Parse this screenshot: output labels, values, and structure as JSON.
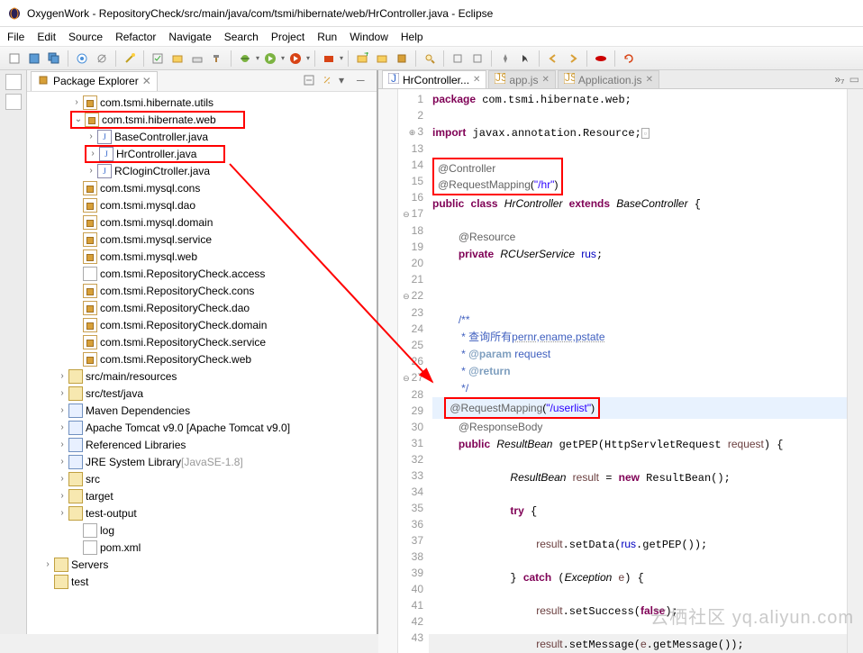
{
  "title": "OxygenWork - RepositoryCheck/src/main/java/com/tsmi/hibernate/web/HrController.java - Eclipse",
  "menubar": [
    "File",
    "Edit",
    "Source",
    "Refactor",
    "Navigate",
    "Search",
    "Project",
    "Run",
    "Window",
    "Help"
  ],
  "explorer": {
    "title": "Package Explorer",
    "items": [
      {
        "indent": 3,
        "twist": ">",
        "icon": "pkg",
        "label": "com.tsmi.hibernate.utils"
      },
      {
        "indent": 3,
        "twistOpen": true,
        "icon": "pkg",
        "label": "com.tsmi.hibernate.web",
        "hl": true
      },
      {
        "indent": 4,
        "twist": ">",
        "icon": "java",
        "label": "BaseController.java"
      },
      {
        "indent": 4,
        "twist": ">",
        "icon": "java",
        "label": "HrController.java",
        "hl": true
      },
      {
        "indent": 4,
        "twist": ">",
        "icon": "java",
        "label": "RCloginCtroller.java"
      },
      {
        "indent": 3,
        "icon": "pkg",
        "label": "com.tsmi.mysql.cons"
      },
      {
        "indent": 3,
        "icon": "pkg",
        "label": "com.tsmi.mysql.dao"
      },
      {
        "indent": 3,
        "icon": "pkg",
        "label": "com.tsmi.mysql.domain"
      },
      {
        "indent": 3,
        "icon": "pkg",
        "label": "com.tsmi.mysql.service"
      },
      {
        "indent": 3,
        "icon": "pkg",
        "label": "com.tsmi.mysql.web"
      },
      {
        "indent": 3,
        "icon": "file",
        "label": "com.tsmi.RepositoryCheck.access"
      },
      {
        "indent": 3,
        "icon": "pkg",
        "label": "com.tsmi.RepositoryCheck.cons"
      },
      {
        "indent": 3,
        "icon": "pkg",
        "label": "com.tsmi.RepositoryCheck.dao"
      },
      {
        "indent": 3,
        "icon": "pkg",
        "label": "com.tsmi.RepositoryCheck.domain"
      },
      {
        "indent": 3,
        "icon": "pkg",
        "label": "com.tsmi.RepositoryCheck.service"
      },
      {
        "indent": 3,
        "icon": "pkg",
        "label": "com.tsmi.RepositoryCheck.web"
      },
      {
        "indent": 2,
        "twist": ">",
        "icon": "fold",
        "label": "src/main/resources"
      },
      {
        "indent": 2,
        "twist": ">",
        "icon": "fold",
        "label": "src/test/java"
      },
      {
        "indent": 2,
        "twist": ">",
        "icon": "jar",
        "label": "Maven Dependencies"
      },
      {
        "indent": 2,
        "twist": ">",
        "icon": "jar",
        "label": "Apache Tomcat v9.0 [Apache Tomcat v9.0]"
      },
      {
        "indent": 2,
        "twist": ">",
        "icon": "jar",
        "label": "Referenced Libraries"
      },
      {
        "indent": 2,
        "twist": ">",
        "icon": "jar",
        "label": "JRE System Library",
        "suffix": " [JavaSE-1.8]"
      },
      {
        "indent": 2,
        "twist": ">",
        "icon": "fold",
        "label": "src"
      },
      {
        "indent": 2,
        "twist": ">",
        "icon": "fold",
        "label": "target"
      },
      {
        "indent": 2,
        "twist": ">",
        "icon": "fold",
        "label": "test-output"
      },
      {
        "indent": 3,
        "icon": "file",
        "label": "log"
      },
      {
        "indent": 3,
        "icon": "file",
        "label": "pom.xml"
      },
      {
        "indent": 1,
        "twist": ">",
        "icon": "fold",
        "label": "Servers"
      },
      {
        "indent": 1,
        "icon": "fold",
        "label": "test"
      }
    ]
  },
  "editor": {
    "tabs": [
      {
        "label": "HrController...",
        "active": true,
        "icon": "java"
      },
      {
        "label": "app.js",
        "icon": "js"
      },
      {
        "label": "Application.js",
        "icon": "js"
      }
    ],
    "more": "»₇",
    "gutter": [
      "1",
      "2",
      "3",
      "",
      "13",
      "14",
      "15",
      "16",
      "17",
      "18",
      "19",
      "20",
      "21",
      "22",
      "23",
      "24",
      "25",
      "26",
      "27",
      "28",
      "29",
      "30",
      "31",
      "32",
      "33",
      "34",
      "35",
      "36",
      "37",
      "38",
      "39",
      "40",
      "41",
      "42",
      "43"
    ],
    "gutter_marks": {
      "1": "",
      "3": "⊕",
      "14": "",
      "17": "⊖",
      "22": "⊖",
      "27": "⊖"
    },
    "code_tokens": {
      "pkg_kw": "package",
      "pkg_name": " com.tsmi.hibernate.web;",
      "imp_kw": "import",
      "imp_name": " javax.annotation.Resource;",
      "ann_ctrl": "@Controller",
      "ann_rm": "@RequestMapping",
      "rm_str": "\"/hr\"",
      "pub": "public",
      "cls": "class",
      "ext": "extends",
      "clsname": "HrController",
      "basecls": "BaseController",
      "resrc": "@Resource",
      "priv": "private",
      "svc": "RCUserService",
      "fld": "rus",
      "cmt_open": "/**",
      "cmt_l1": " * 查询所有",
      "cmt_l1b": "pernr,ename,pstate",
      "cmt_param": "@param",
      "cmt_param_v": " request",
      "cmt_return": "@return",
      "cmt_close": " */",
      "rm2_str": "\"/userlist\"",
      "respbody": "@ResponseBody",
      "rb": "ResultBean",
      "meth": "getPEP",
      "httpreq": "HttpServletRequest",
      "param": "request",
      "res_var": "result",
      "new_kw": "new",
      "try_kw": "try",
      "setdata": "setData",
      "getpep": "getPEP",
      "catch_kw": "catch",
      "exc": "Exception",
      "e": "e",
      "setsucc": "setSuccess",
      "false_kw": "false",
      "setmsg": "setMessage",
      "getmsg": "getMessage"
    }
  },
  "watermark": "云栖社区 yq.aliyun.com"
}
